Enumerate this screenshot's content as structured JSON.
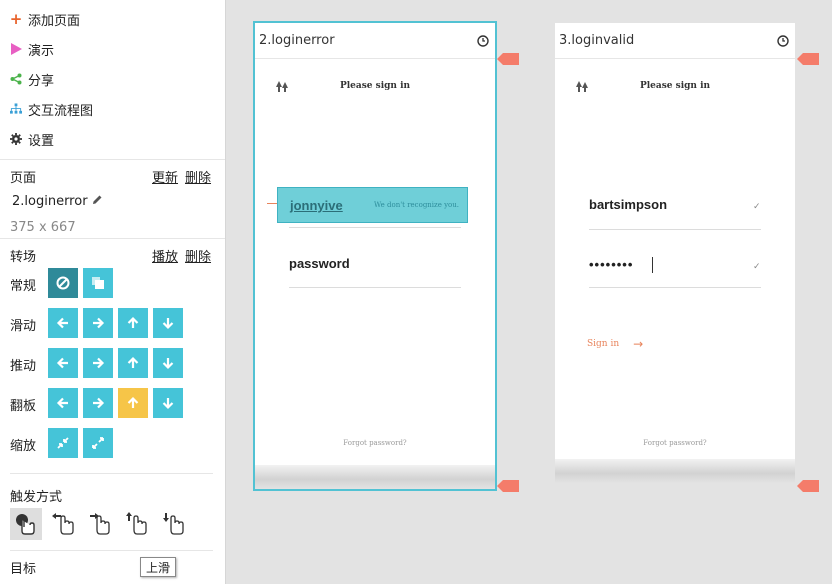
{
  "menu": {
    "add_page": "添加页面",
    "present": "演示",
    "share": "分享",
    "flow": "交互流程图",
    "settings": "设置"
  },
  "page_section": {
    "label": "页面",
    "update": "更新",
    "delete": "删除",
    "page_name": "2.loginerror",
    "size": "375 x 667"
  },
  "transition": {
    "label": "转场",
    "play": "播放",
    "delete": "删除",
    "rows": [
      "常规",
      "滑动",
      "推动",
      "翻板",
      "缩放"
    ]
  },
  "trigger": {
    "label": "触发方式"
  },
  "target": {
    "label": "目标",
    "tooltip": "上滑"
  },
  "cards": [
    {
      "title": "2.loginerror",
      "signin_title": "Please sign in",
      "username": "jonnyive",
      "error_msg": "We don't recognize you.",
      "password": "password",
      "forgot": "Forgot password?"
    },
    {
      "title": "3.loginvalid",
      "signin_title": "Please sign in",
      "username": "bartsimpson",
      "password_mask": "••••••••",
      "signin_btn": "Sign in",
      "arrow": "→",
      "forgot": "Forgot password?"
    }
  ],
  "colors": {
    "accent": "#45c4d8",
    "accent_dark": "#2f8a99",
    "highlight": "#f6c548",
    "flag": "#f47c6a",
    "signin": "#e8845c"
  }
}
